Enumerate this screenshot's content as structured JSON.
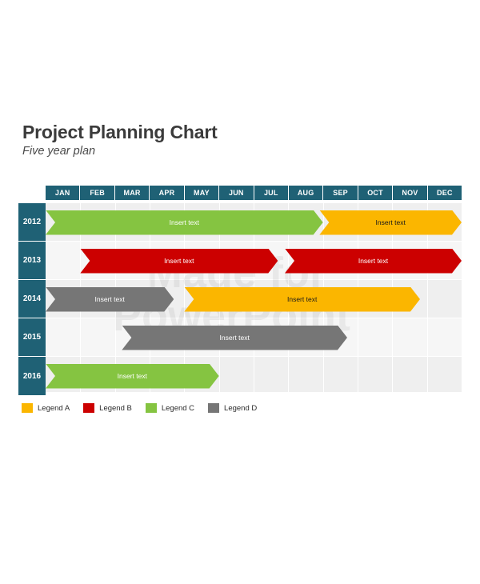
{
  "header": {
    "title": "Project Planning Chart",
    "subtitle": "Five year plan"
  },
  "watermark": {
    "line1": "Made for",
    "line2": "PowerPoint"
  },
  "colors": {
    "teal": "#1f6175",
    "yellow": "#fbb600",
    "red": "#cc0000",
    "green": "#85c441",
    "gray": "#767676",
    "plot_background": "#efefef",
    "row_alt": "#f6f6f6",
    "gridline": "#ffffff",
    "title_text": "#3b3b3b"
  },
  "chart_data": {
    "type": "bar",
    "title": "Project Planning Chart",
    "subtitle": "Five year plan",
    "xlabel": "",
    "ylabel": "",
    "grid": true,
    "legend_position": "bottom-left",
    "categories": [
      "JAN",
      "FEB",
      "MAR",
      "APR",
      "MAY",
      "JUN",
      "JUL",
      "AUG",
      "SEP",
      "OCT",
      "NOV",
      "DEC"
    ],
    "rows": [
      "2012",
      "2013",
      "2014",
      "2015",
      "2016"
    ],
    "legend": [
      {
        "label": "Legend A",
        "color": "#fbb600"
      },
      {
        "label": "Legend B",
        "color": "#cc0000"
      },
      {
        "label": "Legend C",
        "color": "#85c441"
      },
      {
        "label": "Legend D",
        "color": "#767676"
      }
    ],
    "bars": [
      {
        "row": "2012",
        "label": "Insert text",
        "color": "#85c441",
        "legend": "Legend C",
        "start_month": 1.0,
        "end_month": 9.0,
        "dark_label": false
      },
      {
        "row": "2012",
        "label": "Insert text",
        "color": "#fbb600",
        "legend": "Legend A",
        "start_month": 8.9,
        "end_month": 13.0,
        "dark_label": true
      },
      {
        "row": "2013",
        "label": "Insert text",
        "color": "#cc0000",
        "legend": "Legend B",
        "start_month": 2.0,
        "end_month": 7.7,
        "dark_label": false
      },
      {
        "row": "2013",
        "label": "Insert text",
        "color": "#cc0000",
        "legend": "Legend B",
        "start_month": 7.9,
        "end_month": 13.0,
        "dark_label": false
      },
      {
        "row": "2014",
        "label": "Insert text",
        "color": "#767676",
        "legend": "Legend D",
        "start_month": 1.0,
        "end_month": 4.7,
        "dark_label": false
      },
      {
        "row": "2014",
        "label": "Insert text",
        "color": "#fbb600",
        "legend": "Legend A",
        "start_month": 5.0,
        "end_month": 11.8,
        "dark_label": true
      },
      {
        "row": "2015",
        "label": "Insert text",
        "color": "#767676",
        "legend": "Legend D",
        "start_month": 3.2,
        "end_month": 9.7,
        "dark_label": false
      },
      {
        "row": "2016",
        "label": "Insert text",
        "color": "#85c441",
        "legend": "Legend C",
        "start_month": 1.0,
        "end_month": 6.0,
        "dark_label": false
      }
    ]
  }
}
